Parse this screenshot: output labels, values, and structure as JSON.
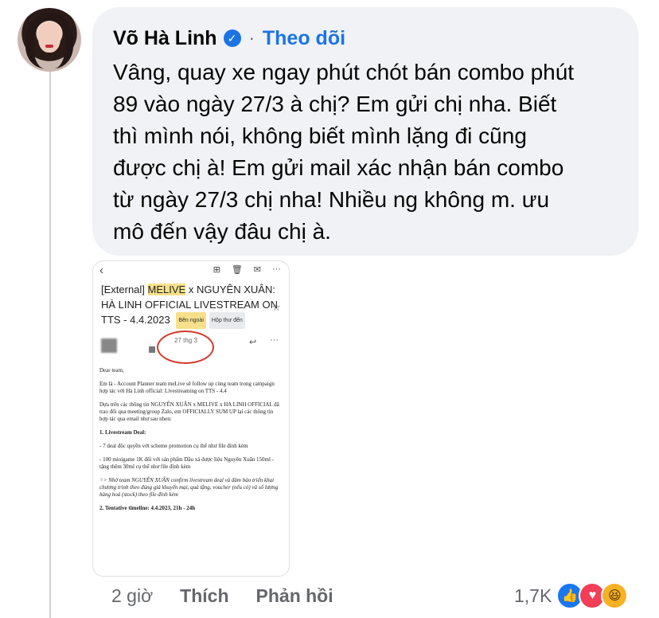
{
  "comment": {
    "author": "Võ Hà Linh",
    "follow_label": "Theo dõi",
    "separator": "·",
    "text": "Vâng, quay xe ngay phút chót bán combo phút\n89 vào ngày 27/3 à chị? Em gửi chị nha. Biết\nthì mình nói, không biết mình lặng đi cũng\nđược chị à! Em gửi mail xác nhận bán combo\ntừ ngày 27/3 chị nha! Nhiều ng không m. ưu\nmô đến vậy đâu chị à."
  },
  "email": {
    "back_icon": "‹",
    "toolbar_icons": [
      "⊞",
      "🗑",
      "✉",
      "···"
    ],
    "subject_prefix": "[External]",
    "subject_brand": "MELIVE",
    "subject_x": "x",
    "subject_name": "NGUYÊN XUÂN:",
    "subject_rest": "HÀ LINH OFFICIAL LIVESTREAM ON TTS - 4.4.2023",
    "tag_external": "Bên ngoài",
    "tag_inbox": "Hộp thư đến",
    "date": "27 thg 3",
    "greeting": "Dear team,",
    "intro": "Em là       - Account Planner team meLive sẽ follow up cùng team trong campaign hợp tác với Hà Linh official: Livestreaming on TTS - 4.4",
    "summary": "Dựa trên các thông tin NGUYÊN XUÂN x MELIVE x HA LINH OFFICIAL đã trao đổi qua meeting/group Zalo, em OFFICIALLY SUM UP lại các thông tin hợp tác qua email như sau nhen:",
    "section1": "1. Livestream Deal:",
    "deal1": "- 7 deal độc quyền với scheme promotion cụ thể như file đính kèm",
    "deal2": "- 100 minigame 1K đối với sản phẩm Dầu xả dược liệu Nguyên Xuân 150ml - tặng thêm 30ml cụ thể như file đính kèm",
    "confirm": "=> Nhờ team NGUYÊN XUÂN confirm livestream deal và đảm bảo triển khai chương trình theo đúng giá khuyến mại, quà tặng, voucher (nếu có) và số lượng hàng hoá (stock) theo file đính kèm",
    "section2": "2. Tentative timeline: 4.4.2023, 21h - 24h"
  },
  "actions": {
    "time": "2 giờ",
    "like_label": "Thích",
    "reply_label": "Phản hồi",
    "reaction_count": "1,7K"
  },
  "colors": {
    "bubble_bg": "#f0f2f5",
    "link_blue": "#1b74e4",
    "muted": "#65676b",
    "like": "#1877f2",
    "love": "#f33e58",
    "haha": "#f7b125"
  }
}
